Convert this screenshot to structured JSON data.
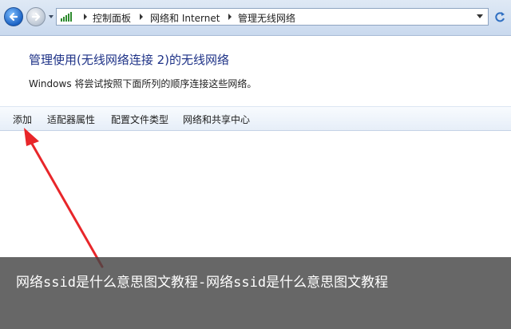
{
  "address_bar": {
    "breadcrumbs": [
      "控制面板",
      "网络和 Internet",
      "管理无线网络"
    ]
  },
  "content": {
    "title": "管理使用(无线网络连接 2)的无线网络",
    "description": "Windows 将尝试按照下面所列的顺序连接这些网络。"
  },
  "toolbar": {
    "add": "添加",
    "adapter_properties": "适配器属性",
    "profile_types": "配置文件类型",
    "network_center": "网络和共享中心"
  },
  "annotation": {
    "arrow_color": "#e8262a"
  },
  "caption": {
    "text": "网络ssid是什么意思图文教程-网络ssid是什么意思图文教程"
  }
}
